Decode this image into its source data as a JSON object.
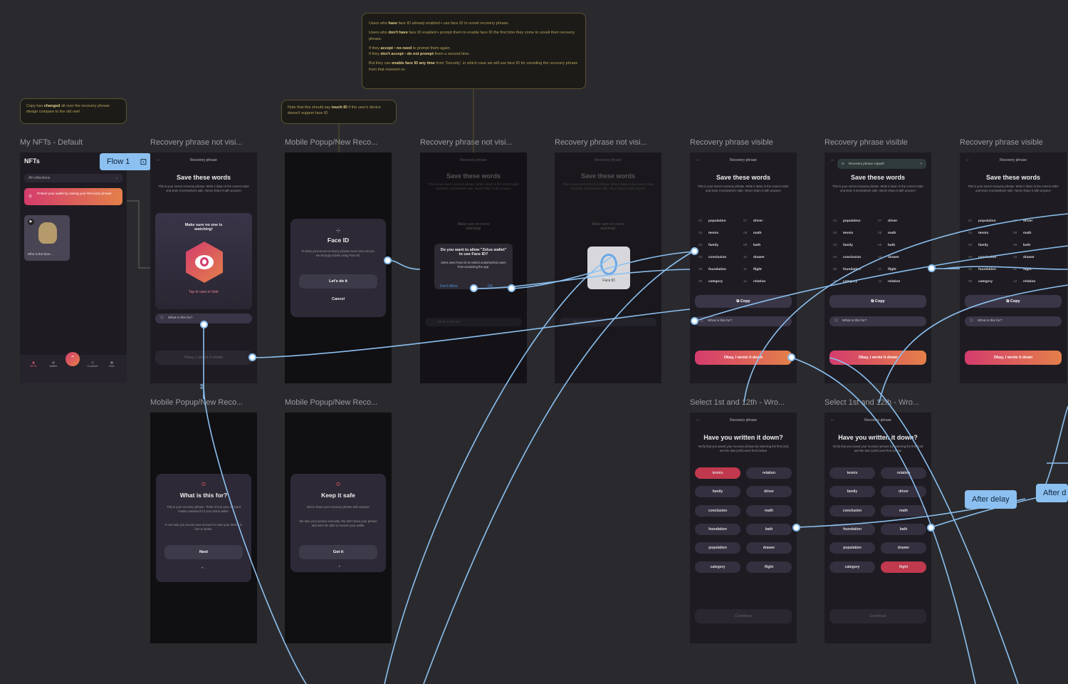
{
  "notes": {
    "copy_prefix": "Copy has ",
    "copy_bold": "changed",
    "copy_rest": " all over the recovery phrase design compare to the old one!",
    "touch_prefix": "Note that this should say ",
    "touch_bold": "touch ID",
    "touch_rest": " if the user's device doesn't support face ID",
    "face_l1a": "Users who ",
    "face_l1b": "have",
    "face_l1c": " face ID already enabled",
    "face_l1d": " use face ID to unveil recovery phrase.",
    "face_l2a": "Users who ",
    "face_l2b": "don't have",
    "face_l2c": " face ID enabled",
    "face_l2d": " prompt them to enable face ID the first time they come to unveil their recovery phrase.",
    "face_l3a": "If they ",
    "face_l3b": "accept",
    "face_l3c": " no need",
    "face_l3d": " to prompt them again.",
    "face_l4a": "If they ",
    "face_l4b": "don't accept",
    "face_l4c": " do not prompt",
    "face_l4d": " them a second time.",
    "face_l5a": "But they can ",
    "face_l5b": "enable face ID any time",
    "face_l5c": " from 'Security', in which case we will use face ID for unveiling the recovery phrase from that moment on"
  },
  "frame_titles": {
    "f1": "My NFTs - Default",
    "f2": "Recovery phrase not visi...",
    "f3": "Mobile Popup/New Reco...",
    "f4": "Recovery phrase not visi...",
    "f5": "Recovery phrase not visi...",
    "f6": "Recovery phrase visible",
    "f7": "Recovery phrase visible",
    "f8": "Recovery phrase visible",
    "f9": "Mobile Popup/New Reco...",
    "f10": "Mobile Popup/New Reco...",
    "f11": "Select 1st and 12th - Wro...",
    "f12": "Select 1st and 12th - Wro..."
  },
  "flow_tag": "Flow 1",
  "delay_tags": [
    "After delay",
    "After d"
  ],
  "nfts": {
    "title": "NFTs",
    "collections": "All collections",
    "banner": "Protect your wallet by saving your Recovery phrase",
    "nft_name": "Who is the bore...",
    "nav": [
      "NFTs",
      "Wallet",
      "",
      "Connect",
      "Hub"
    ]
  },
  "recovery": {
    "header": "Recovery phrase",
    "title": "Save these words",
    "desc": "This is your secret recovery phrase. Write it down in the correct order and store it somewhere safe. Never share it with anyone!",
    "watch": "Make sure no one is watching!",
    "tap": "Tap to view or hide",
    "what": "What is this for?",
    "okay": "Okay, I wrote it down",
    "copy": "Copy",
    "copied": "Recovery phrase copied!"
  },
  "words": [
    [
      "01",
      "population",
      "07",
      "driver"
    ],
    [
      "02",
      "tennis",
      "08",
      "math"
    ],
    [
      "03",
      "family",
      "09",
      "bath"
    ],
    [
      "04",
      "conclusion",
      "10",
      "drawer"
    ],
    [
      "05",
      "foundation",
      "11",
      "flight"
    ],
    [
      "06",
      "category",
      "12",
      "relation"
    ]
  ],
  "faceid_popup": {
    "title": "Face ID",
    "desc": "To keep your secret recovery phrase even more secure, we strongly advise using Face ID.",
    "primary": "Let's do it",
    "cancel": "Cancel"
  },
  "ios_alert": {
    "title": "Do you want to allow \"Zelus wallet\" to use Face ID?",
    "desc": "Zelus uses Face ID to restrict unauthorized users from accessing the app.",
    "deny": "Don't Allow",
    "ok": "OK"
  },
  "faceid_label": "Face ID",
  "whatfor_popup": {
    "title": "What is this for?",
    "desc1": "This is your recovery phrase. Think of it as your 12 word master password for your Zelus wallet.",
    "desc2": "It can help you access your account in case your device is lost or stolen.",
    "btn": "Next"
  },
  "safe_popup": {
    "title": "Keep it safe",
    "desc1": "Never share your recovery phrase with anyone!",
    "desc2": "We take your privacy seriously. We don't know your phrase and won't be able to recover your wallet.",
    "btn": "Got it"
  },
  "verify": {
    "header": "Recovery phrase",
    "title": "Have you written it down?",
    "desc": "Verify that you saved your recovery phrase by selecting the first (1st) and the last (12th) word from below!",
    "pills": [
      [
        "tennis",
        "relation"
      ],
      [
        "family",
        "driver"
      ],
      [
        "conclusion",
        "math"
      ],
      [
        "foundation",
        "bath"
      ],
      [
        "population",
        "drawer"
      ],
      [
        "category",
        "flight"
      ]
    ],
    "continue": "Continue"
  },
  "colors": {
    "accent_link": "#8cc0f0",
    "gradient_start": "#d43c6d",
    "gradient_end": "#e4804a",
    "wrong": "#c0394e"
  }
}
